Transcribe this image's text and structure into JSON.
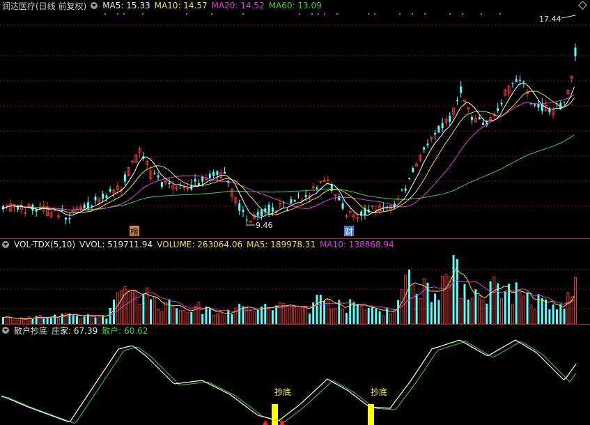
{
  "price_panel": {
    "title": "润达医疗(日线 前复权)",
    "ma5": "MA5: 15.33",
    "ma10": "MA10: 14.57",
    "ma20": "MA20: 14.52",
    "ma60": "MA60: 13.09",
    "high_label": "17.44",
    "low_label": "9.46",
    "mark_bang": "榜",
    "mark_cai": "财"
  },
  "volume_panel": {
    "title": "VOL-TDX(5,10)",
    "vvol": "VVOL: 519711.94",
    "volume": "VOLUME: 263064.06",
    "ma5": "MA5: 189978.31",
    "ma10": "MA10: 138868.94"
  },
  "indicator_panel": {
    "title": "散户抄底",
    "zhuangjia": "庄家: 67.39",
    "sanhu": "散户: 60.62",
    "signal1": "抄底",
    "signal2": "抄底"
  },
  "colors": {
    "up": "#e83434",
    "down": "#54ffff",
    "ma5": "#ffffff",
    "ma10": "#f0e040",
    "ma20": "#e040e0",
    "ma60": "#40d040",
    "grid": "#8a1a1a"
  }
}
